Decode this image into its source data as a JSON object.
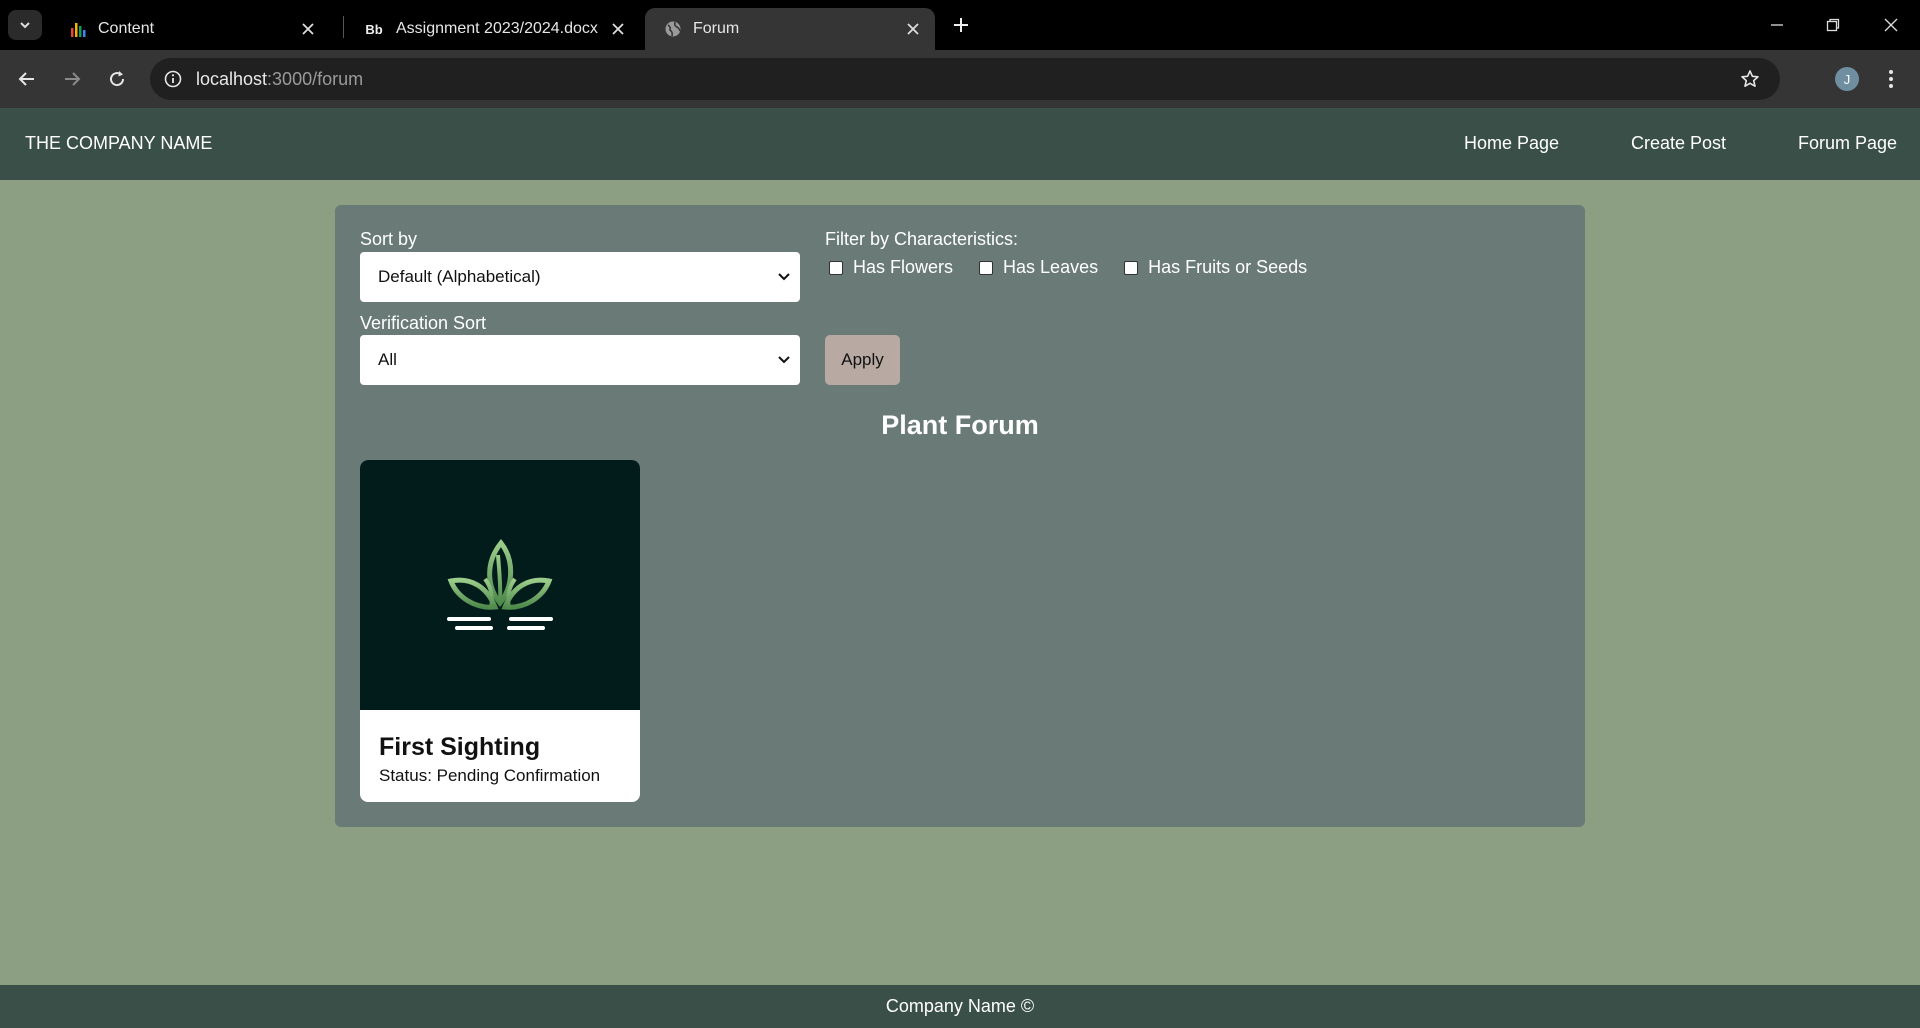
{
  "browser": {
    "tabs": [
      {
        "title": "Content",
        "icon": "bar-chart-icon",
        "active": false
      },
      {
        "title": "Assignment 2023/2024.docx",
        "icon": "Bb",
        "active": false
      },
      {
        "title": "Forum",
        "icon": "globe-icon",
        "active": true
      }
    ],
    "url_host": "localhost",
    "url_path": ":3000/forum",
    "profile_initial": "J"
  },
  "nav": {
    "brand": "THE COMPANY NAME",
    "links": [
      "Home Page",
      "Create Post",
      "Forum Page"
    ]
  },
  "filters": {
    "sort_label": "Sort by",
    "sort_value": "Default (Alphabetical)",
    "verification_label": "Verification Sort",
    "verification_value": "All",
    "characteristics_label": "Filter by Characteristics:",
    "characteristics": [
      {
        "label": "Has Flowers",
        "checked": false
      },
      {
        "label": "Has Leaves",
        "checked": false
      },
      {
        "label": "Has Fruits or Seeds",
        "checked": false
      }
    ],
    "apply_label": "Apply"
  },
  "forum": {
    "title": "Plant Forum",
    "posts": [
      {
        "title": "First Sighting",
        "status": "Status: Pending Confirmation",
        "image": "plant-sprout-logo"
      }
    ]
  },
  "footer": {
    "text": "Company Name ©"
  },
  "colors": {
    "page_bg": "#8c9f82",
    "nav_bg": "#3a4f47",
    "panel_bg": "#6a7b77",
    "apply_bg": "#b8a9a3",
    "card_image_bg": "#021c1c"
  }
}
